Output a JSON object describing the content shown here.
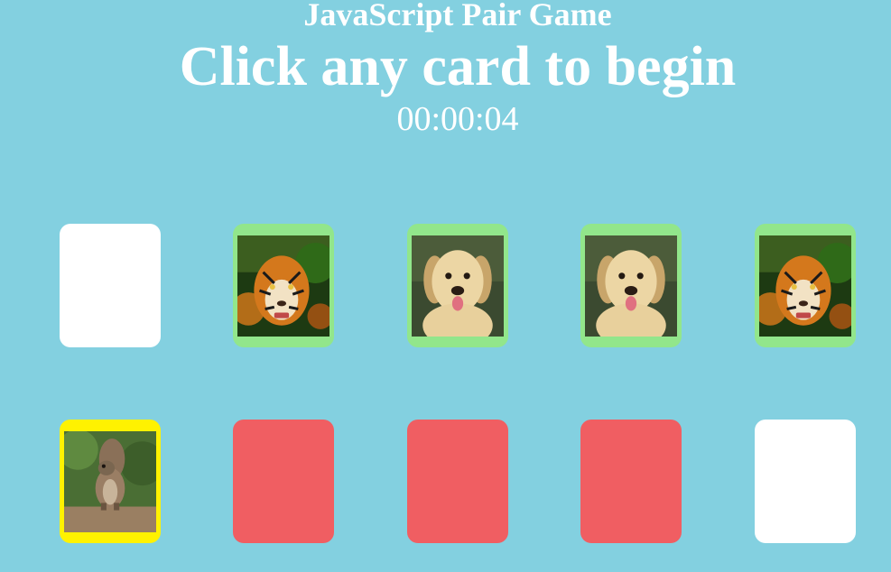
{
  "header": {
    "title": "JavaScript Pair Game",
    "status": "Click any card to begin",
    "timer": "00:00:04"
  },
  "cards": [
    {
      "state": "face-down",
      "image": null
    },
    {
      "state": "matched",
      "image": "tiger"
    },
    {
      "state": "matched",
      "image": "puppy"
    },
    {
      "state": "matched",
      "image": "puppy"
    },
    {
      "state": "matched",
      "image": "tiger"
    },
    {
      "state": "selected",
      "image": "squirrel"
    },
    {
      "state": "wrong",
      "image": null
    },
    {
      "state": "wrong",
      "image": null
    },
    {
      "state": "wrong",
      "image": null
    },
    {
      "state": "face-down",
      "image": null
    }
  ],
  "colors": {
    "background": "#83d0e0",
    "face_down": "#ffffff",
    "matched_border": "#92e68b",
    "selected_border": "#fff200",
    "wrong": "#f05e62"
  }
}
